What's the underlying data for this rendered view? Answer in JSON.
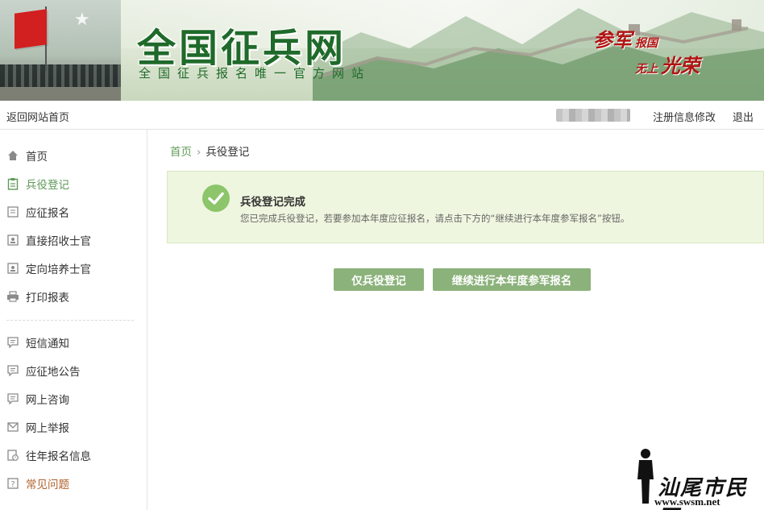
{
  "banner": {
    "title": "全国征兵网",
    "subtitle": "全国征兵报名唯一官方网站",
    "slogan_line1_big": "参军",
    "slogan_line1_small": "报国",
    "slogan_line2_small": "无上",
    "slogan_line2_big": "光荣"
  },
  "topbar": {
    "back_home": "返回网站首页",
    "edit_registration": "注册信息修改",
    "logout": "退出"
  },
  "sidebar": {
    "items": [
      {
        "label": "首页",
        "icon": "home-icon"
      },
      {
        "label": "兵役登记",
        "icon": "clipboard-icon",
        "active": true
      },
      {
        "label": "应征报名",
        "icon": "document-icon"
      },
      {
        "label": "直接招收士官",
        "icon": "id-card-icon"
      },
      {
        "label": "定向培养士官",
        "icon": "id-card-icon"
      },
      {
        "label": "打印报表",
        "icon": "printer-icon"
      },
      {
        "label": "短信通知",
        "icon": "message-icon"
      },
      {
        "label": "应征地公告",
        "icon": "message-icon"
      },
      {
        "label": "网上咨询",
        "icon": "message-icon"
      },
      {
        "label": "网上举报",
        "icon": "mail-icon"
      },
      {
        "label": "往年报名信息",
        "icon": "history-icon"
      },
      {
        "label": "常见问题",
        "icon": "question-icon"
      }
    ]
  },
  "breadcrumb": {
    "home": "首页",
    "current": "兵役登记"
  },
  "notice": {
    "title": "兵役登记完成",
    "text": "您已完成兵役登记，若要参加本年度应征报名，请点击下方的“继续进行本年度参军报名”按钮。"
  },
  "buttons": {
    "register_only": "仅兵役登记",
    "continue_enlist": "继续进行本年度参军报名"
  },
  "watermark": {
    "text": "汕尾市民网",
    "url": "www.swsm.net"
  },
  "colors": {
    "accent_green": "#5f9a58",
    "button_green": "#8bb27a",
    "notice_bg": "#eef6df",
    "check_green": "#8cc56a",
    "title_green": "#1f6a2a",
    "slogan_red": "#b21414",
    "faq_orange": "#b0612c"
  }
}
